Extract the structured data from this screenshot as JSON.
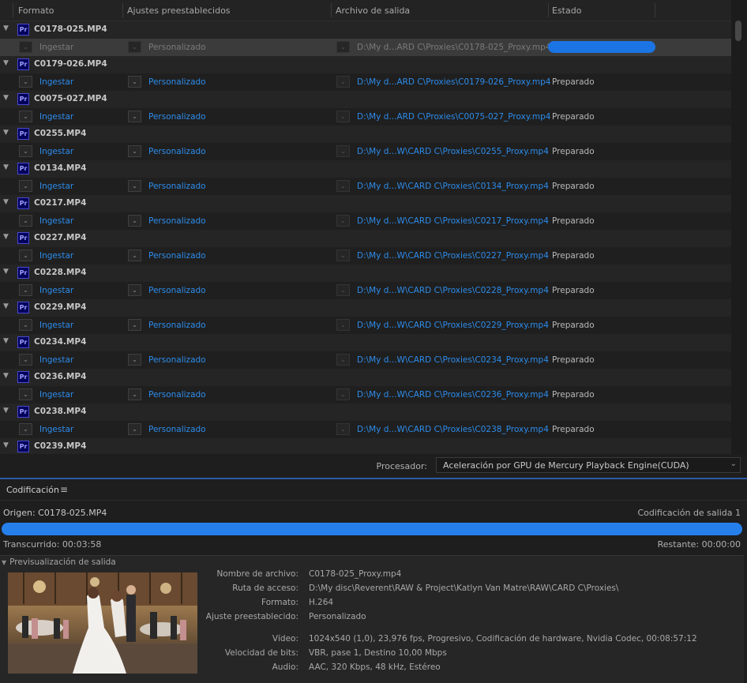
{
  "queue_header": {
    "col_format": "Formato",
    "col_preset": "Ajustes preestablecidos",
    "col_output": "Archivo de salida",
    "col_status": "Estado"
  },
  "queue": [
    {
      "source": "C0178-025.MP4",
      "format": "Ingestar",
      "preset": "Personalizado",
      "output": "D:\\My d...ARD C\\Proxies\\C0178-025_Proxy.mp4",
      "status": "",
      "progress": 1.0,
      "selected": true
    },
    {
      "source": "C0179-026.MP4",
      "format": "Ingestar",
      "preset": "Personalizado",
      "output": "D:\\My d...ARD C\\Proxies\\C0179-026_Proxy.mp4",
      "status": "Preparado"
    },
    {
      "source": "C0075-027.MP4",
      "format": "Ingestar",
      "preset": "Personalizado",
      "output": "D:\\My d...ARD C\\Proxies\\C0075-027_Proxy.mp4",
      "status": "Preparado"
    },
    {
      "source": "C0255.MP4",
      "format": "Ingestar",
      "preset": "Personalizado",
      "output": "D:\\My d...W\\CARD C\\Proxies\\C0255_Proxy.mp4",
      "status": "Preparado"
    },
    {
      "source": "C0134.MP4",
      "format": "Ingestar",
      "preset": "Personalizado",
      "output": "D:\\My d...W\\CARD C\\Proxies\\C0134_Proxy.mp4",
      "status": "Preparado"
    },
    {
      "source": "C0217.MP4",
      "format": "Ingestar",
      "preset": "Personalizado",
      "output": "D:\\My d...W\\CARD C\\Proxies\\C0217_Proxy.mp4",
      "status": "Preparado"
    },
    {
      "source": "C0227.MP4",
      "format": "Ingestar",
      "preset": "Personalizado",
      "output": "D:\\My d...W\\CARD C\\Proxies\\C0227_Proxy.mp4",
      "status": "Preparado"
    },
    {
      "source": "C0228.MP4",
      "format": "Ingestar",
      "preset": "Personalizado",
      "output": "D:\\My d...W\\CARD C\\Proxies\\C0228_Proxy.mp4",
      "status": "Preparado"
    },
    {
      "source": "C0229.MP4",
      "format": "Ingestar",
      "preset": "Personalizado",
      "output": "D:\\My d...W\\CARD C\\Proxies\\C0229_Proxy.mp4",
      "status": "Preparado"
    },
    {
      "source": "C0234.MP4",
      "format": "Ingestar",
      "preset": "Personalizado",
      "output": "D:\\My d...W\\CARD C\\Proxies\\C0234_Proxy.mp4",
      "status": "Preparado"
    },
    {
      "source": "C0236.MP4",
      "format": "Ingestar",
      "preset": "Personalizado",
      "output": "D:\\My d...W\\CARD C\\Proxies\\C0236_Proxy.mp4",
      "status": "Preparado"
    },
    {
      "source": "C0238.MP4",
      "format": "Ingestar",
      "preset": "Personalizado",
      "output": "D:\\My d...W\\CARD C\\Proxies\\C0238_Proxy.mp4",
      "status": "Preparado"
    },
    {
      "source": "C0239.MP4"
    }
  ],
  "processor": {
    "label": "Procesador:",
    "value": "Aceleración por GPU de Mercury Playback Engine(CUDA)"
  },
  "encoding": {
    "tab_label": "Codificación",
    "origin": "Origen: C0178-025.MP4",
    "output_count": "Codificación de salida 1",
    "progress": 1.0,
    "elapsed": "Transcurrido: 00:03:58",
    "remaining": "Restante: 00:00:00",
    "preview_header": "Previsualización de salida",
    "details": [
      {
        "label": "Nombre de archivo:",
        "value": "C0178-025_Proxy.mp4"
      },
      {
        "label": "Ruta de acceso:",
        "value": "D:\\My disc\\Reverent\\RAW & Project\\Katlyn Van Matre\\RAW\\CARD C\\Proxies\\"
      },
      {
        "label": "Formato:",
        "value": "H.264"
      },
      {
        "label": "Ajuste preestablecido:",
        "value": "Personalizado"
      },
      {
        "label": "Vídeo:",
        "value": "1024x540 (1,0), 23,976 fps, Progresivo, Codificación de hardware, Nvidia Codec, 00:08:57:12"
      },
      {
        "label": "Velocidad de bits:",
        "value": "VBR, pase 1, Destino 10,00 Mbps"
      },
      {
        "label": "Audio:",
        "value": "AAC, 320 Kbps, 48 kHz, Estéreo"
      }
    ]
  },
  "colors": {
    "accent": "#2680eb",
    "link": "#2d8ceb",
    "app_badge": "#00005b"
  },
  "icons": {
    "app": "premiere-pro-icon",
    "expand": "chevron-down-icon",
    "menu": "hamburger-menu-icon",
    "dropdown": "dropdown-caret-icon"
  }
}
